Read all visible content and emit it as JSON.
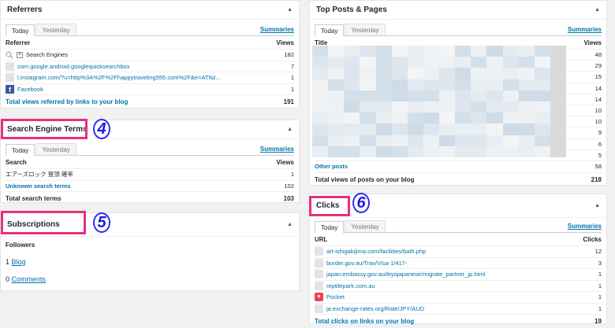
{
  "referrers": {
    "title": "Referrers",
    "tabs": [
      "Today",
      "Yesterday"
    ],
    "summaries": "Summaries",
    "col1": "Referrer",
    "col2": "Views",
    "rows": [
      {
        "label": "Search Engines",
        "value": "182"
      },
      {
        "label": "com.google.android.googlequicksearchbox",
        "value": "7"
      },
      {
        "label": "l.instagram.com/?u=http%3A%2F%2Fhappytraveling555.com%2F&e=ATNz...",
        "value": "1"
      },
      {
        "label": "Facebook",
        "value": "1"
      }
    ],
    "total_label": "Total views referred by links to your blog",
    "total_value": "191"
  },
  "search_terms": {
    "title": "Search Engine Terms",
    "tabs": [
      "Today",
      "Yesterday"
    ],
    "summaries": "Summaries",
    "col1": "Search",
    "col2": "Views",
    "rows": [
      {
        "label": "エアーズロック 登頂 確率",
        "value": "1"
      },
      {
        "label": "Unknown search terms",
        "value": "102"
      }
    ],
    "total_label": "Total search terms",
    "total_value": "103",
    "callout_number": "4"
  },
  "subscriptions": {
    "title": "Subscriptions",
    "followers_label": "Followers",
    "blog_count": "1",
    "blog_label": "Blog",
    "comments_count": "0",
    "comments_label": "Comments",
    "callout_number": "5"
  },
  "top_posts": {
    "title": "Top Posts & Pages",
    "tabs": [
      "Today",
      "Yesterday"
    ],
    "summaries": "Summaries",
    "col1": "Title",
    "col2": "Views",
    "values": [
      "48",
      "29",
      "15",
      "14",
      "14",
      "10",
      "10",
      "9",
      "6",
      "5"
    ],
    "other_label": "Other posts",
    "other_value": "58",
    "total_label": "Total views of posts on your blog",
    "total_value": "218"
  },
  "clicks": {
    "title": "Clicks",
    "tabs": [
      "Today",
      "Yesterday"
    ],
    "summaries": "Summaries",
    "col1": "URL",
    "col2": "Clicks",
    "rows": [
      {
        "label": "art-ishigakijima.com/facilities/bath.php",
        "value": "12"
      },
      {
        "label": "border.gov.au/Trav/Visa-1/417-",
        "value": "3"
      },
      {
        "label": "japan.embassy.gov.au/tkyojapanese/migrate_partner_jp.html",
        "value": "1"
      },
      {
        "label": "reptilepark.com.au",
        "value": "1"
      },
      {
        "label": "Pocket",
        "value": "1"
      },
      {
        "label": "ja.exchange-rates.org/Rate/JPY/AUD",
        "value": "1"
      }
    ],
    "total_label": "Total clicks on links on your blog",
    "total_value": "19",
    "callout_number": "6"
  },
  "colors": {
    "link": "#0073aa",
    "callout_border": "#e6317d",
    "number_badge": "#2e2ef0"
  }
}
